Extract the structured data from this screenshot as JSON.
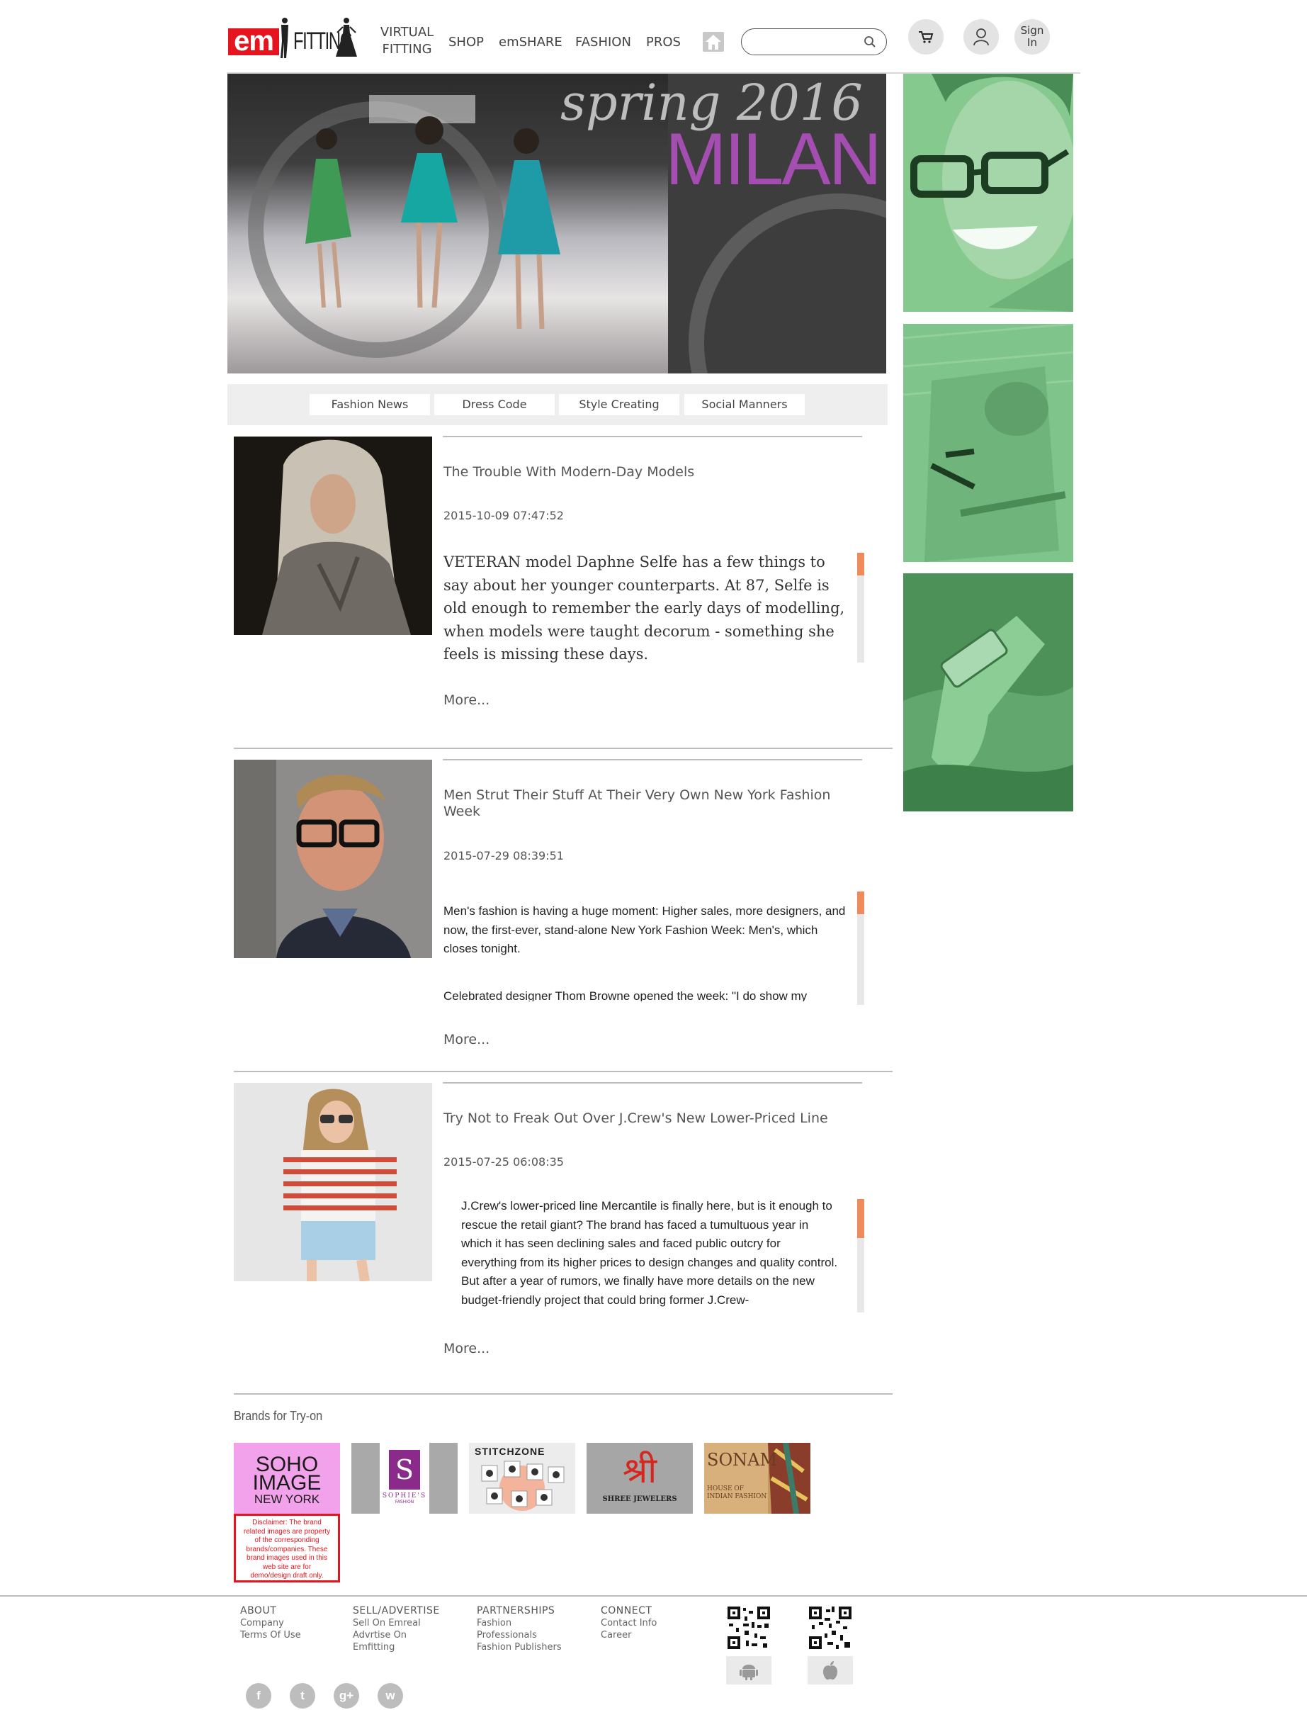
{
  "header": {
    "logo": {
      "em": "em",
      "fitting": "FITTING"
    },
    "nav": {
      "virtual_line1": "VIRTUAL",
      "virtual_line2": "FITTING",
      "shop": "SHOP",
      "emshare": "emSHARE",
      "fashion": "FASHION",
      "pros": "PROS"
    },
    "search": {
      "placeholder": "",
      "value": ""
    },
    "signin_line1": "Sign",
    "signin_line2": "In"
  },
  "hero": {
    "spring": "spring 2016",
    "city": "MILAN"
  },
  "tabs": [
    "Fashion News",
    "Dress Code",
    "Style Creating",
    "Social Manners"
  ],
  "articles": [
    {
      "title": "The Trouble With Modern-Day Models",
      "date": "2015-10-09 07:47:52",
      "body": "VETERAN model Daphne Selfe has a few things to say about her younger counterparts. At 87, Selfe is old enough to remember the early days of modelling, when models were taught decorum - something she feels is missing these days.",
      "more": "More..."
    },
    {
      "title": "Men Strut Their Stuff At Their Very Own New York Fashion Week",
      "date": "2015-07-29 08:39:51",
      "body": "Men's fashion is having a huge moment: Higher sales, more designers, and now, the first-ever, stand-alone New York Fashion Week: Men's, which closes tonight.",
      "body2": "Celebrated designer Thom Browne opened the week: \"I do show my",
      "more": "More..."
    },
    {
      "title": "Try Not to Freak Out Over J.Crew's New Lower-Priced Line",
      "date": "2015-07-25 06:08:35",
      "body": "J.Crew's lower-priced line Mercantile is finally here, but is it enough to rescue the retail giant? The brand has faced a tumultuous year in which it has seen declining sales and faced public outcry for everything from its higher prices to design changes and quality control. But after a year of rumors, we finally have more details on the new budget-friendly project that could bring former J.Crew-",
      "more": "More..."
    }
  ],
  "brands": {
    "title": "Brands for Try-on",
    "soho": {
      "line1": "SOHO",
      "line2": "IMAGE",
      "line3": "NEW YORK"
    },
    "disclaimer": "Disclaimer: The brand related images are property of the corresponding brands/companies. These brand images used in this web site are for demo/design draft only.",
    "sophies": {
      "letter": "S",
      "name": "SOPHIE'S",
      "sub": "FASHION"
    },
    "stitchzone": "STITCHZONE",
    "shree": {
      "glyph": "श्री",
      "name": "SHREE JEWELERS"
    },
    "sonam": {
      "name": "SONAM",
      "sub1": "HOUSE OF",
      "sub2": "INDIAN FASHION"
    }
  },
  "footer": {
    "about": {
      "head": "ABOUT",
      "items": [
        "Company",
        "Terms Of Use"
      ]
    },
    "sell": {
      "head": "SELL/ADVERTISE",
      "items": [
        "Sell On Emreal",
        "Advrtise On",
        "Emfitting"
      ]
    },
    "partnerships": {
      "head": "PARTNERSHIPS",
      "items": [
        "Fashion",
        "Professionals",
        "Fashion Publishers"
      ]
    },
    "connect": {
      "head": "CONNECT",
      "items": [
        "Contact Info",
        "Career"
      ]
    },
    "social": [
      "f",
      "t",
      "g+",
      "w"
    ]
  },
  "colors": {
    "brand_red": "#e4151e",
    "milan_purple": "#a54eb1",
    "side_green": "#7fc48a",
    "scroll_orange": "#ef8a5d"
  },
  "icons": [
    "search-icon",
    "home-icon",
    "cart-icon",
    "user-icon",
    "android-icon",
    "apple-icon",
    "facebook-icon",
    "twitter-icon",
    "google-plus-icon",
    "wechat-icon"
  ]
}
